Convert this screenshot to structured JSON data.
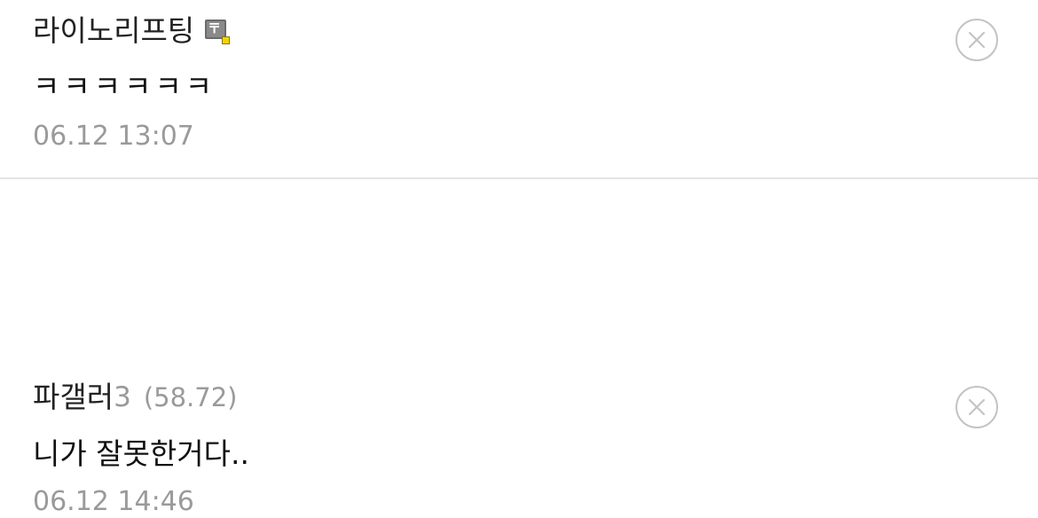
{
  "comments": [
    {
      "author": "라이노리프팅",
      "author_suffix": "",
      "ip": "",
      "badge_icon": "user-level-badge-icon",
      "body": "ㅋㅋㅋㅋㅋㅋ",
      "timestamp": "06.12 13:07"
    },
    {
      "author": "파갤러",
      "author_suffix": "3",
      "ip": "(58.72)",
      "body": "니가 잘못한거다..",
      "timestamp": "06.12 14:46"
    }
  ],
  "delete_icon": "close-circle-icon",
  "colors": {
    "text": "#111111",
    "muted": "#9a9a9a",
    "divider": "#e3e3e3",
    "delete_icon": "#c4c4c4",
    "badge_dot": "#f2d400"
  }
}
